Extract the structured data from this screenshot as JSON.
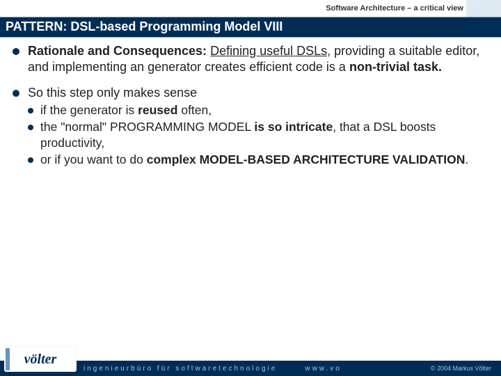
{
  "header": {
    "subtitle": "Software Architecture – a critical view"
  },
  "title": "PATTERN: DSL-based Programming Model VIII",
  "bullets": [
    {
      "html": "<b>Rationale and Consequences:</b> <u>Defining useful DSLs,</u> providing a suitable editor, and implementing an generator creates efficient code is a <b>non-trivial task.</b>"
    },
    {
      "html": "So this step only makes sense",
      "sub": [
        "if the generator is <b>reused</b> often,",
        "the \"normal\" PROGRAMMING MODEL <b>is so intricate</b>, that a DSL boosts productivity,",
        "or if you want to do <b>complex MODEL-BASED ARCHITECTURE VALIDATION</b>."
      ]
    }
  ],
  "footer": {
    "tagline": "ingenieurbüro für softwaretechnologie",
    "url": "www.vo",
    "copyright": "© 2004 Markus Völter"
  },
  "logo": "völter"
}
